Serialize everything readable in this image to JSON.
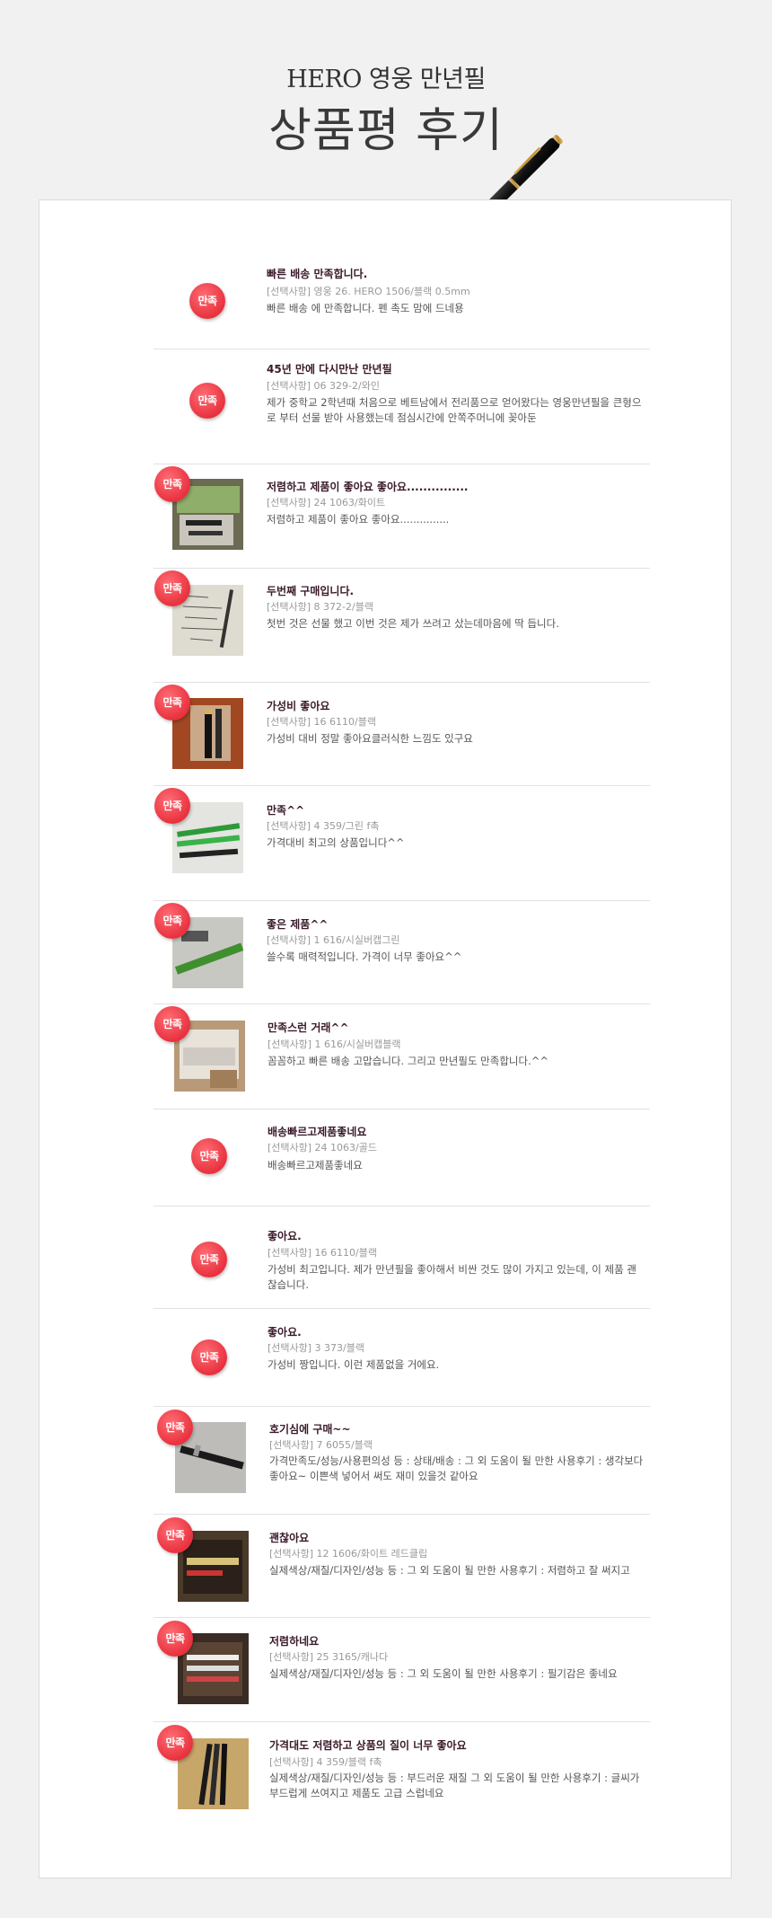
{
  "header": {
    "subtitle": "HERO 영웅 만년필",
    "title": "상품평 후기"
  },
  "colors": {
    "badge": "#e8323e",
    "title": "#3a1a2a",
    "page_bg": "#f1f1f1"
  },
  "reviews": [
    {
      "badge": "만족",
      "title": "빠른 배송 만족합니다.",
      "option": "[선택사항] 영웅 26. HERO 1506/블랙 0.5mm",
      "text": "빠른 배송 에 만족합니다. 펜 촉도 맘에 드네용",
      "photo": false
    },
    {
      "badge": "만족",
      "title": "45년 만에 다시만난 만년필",
      "option": "[선택사항] 06 329-2/와인",
      "text": "제가 중학교 2학년때 처음으로 베트남에서 전리품으로 얻어왔다는 영웅만년필을 큰형으로 부터 선물 받아 사용했는데 점심시간에 안쪽주머니에 꽂아둔",
      "photo": false
    },
    {
      "badge": "만족",
      "title": "저렴하고 제품이 좋아요 좋아요...............",
      "option": "[선택사항] 24 1063/화이트",
      "text": "저렴하고 제품이 좋아요 좋아요...............",
      "photo": true,
      "photo_icon": "pens-in-box-photo"
    },
    {
      "badge": "만족",
      "title": "두번째 구매입니다.",
      "option": "[선택사항] 8 372-2/블랙",
      "text": "첫번 것은 선물 했고 이번 것은 제가 쓰려고 샀는데마음에 딱 듭니다.",
      "photo": true,
      "photo_icon": "handwriting-photo"
    },
    {
      "badge": "만족",
      "title": "가성비 좋아요",
      "option": "[선택사항] 16 6110/블랙",
      "text": "가성비 대비 정말 좋아요클러식한 느낌도 있구요",
      "photo": true,
      "photo_icon": "pen-case-photo"
    },
    {
      "badge": "만족",
      "title": "만족^^",
      "option": "[선택사항] 4 359/그린 f촉",
      "text": "가격대비 최고의 상품입니다^^",
      "photo": true,
      "photo_icon": "green-pens-photo"
    },
    {
      "badge": "만족",
      "title": "좋은 제품^^",
      "option": "[선택사항] 1 616/시실버캡그린",
      "text": "쓸수록 매력적입니다. 가격이 너무 좋아요^^",
      "photo": true,
      "photo_icon": "green-pen-photo"
    },
    {
      "badge": "만족",
      "title": "만족스런 거래^^",
      "option": "[선택사항] 1 616/시실버캡블랙",
      "text": "꼼꼼하고 빠른 배송 고맙습니다. 그리고 만년필도 만족합니다.^^",
      "photo": true,
      "photo_icon": "parcel-box-photo"
    },
    {
      "badge": "만족",
      "title": "배송빠르고제품좋네요",
      "option": "[선택사항] 24 1063/골드",
      "text": "배송빠르고제품좋네요",
      "photo": false
    },
    {
      "badge": "만족",
      "title": "좋아요.",
      "option": "[선택사항] 16 6110/블랙",
      "text": "가성비 최고입니다. 제가 만년필을 좋아해서 비싼 것도 많이 가지고 있는데, 이 제품 괜찮습니다.",
      "photo": false
    },
    {
      "badge": "만족",
      "title": "좋아요.",
      "option": "[선택사항] 3 373/블랙",
      "text": "가성비 짱입니다. 이런 제품없을 거에요.",
      "photo": false
    },
    {
      "badge": "만족",
      "title": "호기심에 구매~~",
      "option": "[선택사항] 7 6055/블랙",
      "text": "가격만족도/성능/사용편의성 등 : 상태/배송 : 그 외 도움이 될 만한 사용후기 : 생각보다 좋아요~ 이쁜색 넣어서 써도 재미 있을것 같아요",
      "photo": true,
      "photo_icon": "black-pen-photo"
    },
    {
      "badge": "만족",
      "title": "괜찮아요",
      "option": "[선택사항] 12 1606/화이트 레드클립",
      "text": "실제색상/재질/디자인/성능 등 : 그 외 도움이 될 만한 사용후기 : 저렴하고 잘 써지고",
      "photo": true,
      "photo_icon": "boxed-pen-photo"
    },
    {
      "badge": "만족",
      "title": "저렴하네요",
      "option": "[선택사항] 25 3165/캐나다",
      "text": "실제색상/재질/디자인/성능 등 : 그 외 도움이 될 만한 사용후기 : 필기감은 좋네요",
      "photo": true,
      "photo_icon": "boxed-pens-photo"
    },
    {
      "badge": "만족",
      "title": "가격대도 저렴하고 상품의 질이 너무 좋아요",
      "option": "[선택사항] 4 359/블랙 f촉",
      "text": "실제색상/재질/디자인/성능 등 : 부드러운 재질 그 외 도움이 될 만한 사용후기 : 글씨가 부드럽게 쓰여지고 제품도 고급 스럽네요",
      "photo": true,
      "photo_icon": "three-pens-photo"
    }
  ]
}
